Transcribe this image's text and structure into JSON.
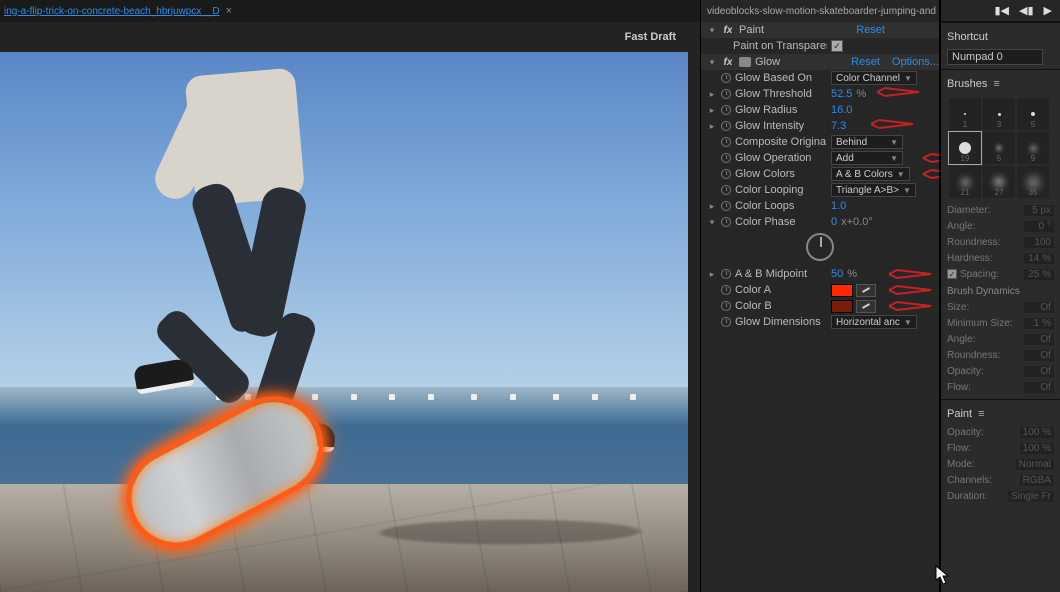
{
  "left": {
    "tab_label": "ing-a-flip-trick-on-concrete-beach_hbrjuwpcx__D",
    "draft_label": "Fast Draft"
  },
  "effects": {
    "tab_label": "videoblocks-slow-motion-skateboarder-jumping-and",
    "paint": {
      "label": "Paint",
      "reset": "Reset",
      "transparent_label": "Paint on Transparent",
      "transparent_checked": true
    },
    "glow": {
      "label": "Glow",
      "reset": "Reset",
      "options": "Options...",
      "based_on": {
        "label": "Glow Based On",
        "value": "Color Channel"
      },
      "threshold": {
        "label": "Glow Threshold",
        "value": "52.5",
        "unit": "%"
      },
      "radius": {
        "label": "Glow Radius",
        "value": "16.0"
      },
      "intensity": {
        "label": "Glow Intensity",
        "value": "7.3"
      },
      "composite": {
        "label": "Composite Origina",
        "value": "Behind"
      },
      "operation": {
        "label": "Glow Operation",
        "value": "Add"
      },
      "colors": {
        "label": "Glow Colors",
        "value": "A & B Colors"
      },
      "looping": {
        "label": "Color Looping",
        "value": "Triangle A>B>"
      },
      "loops": {
        "label": "Color Loops",
        "value": "1.0"
      },
      "phase": {
        "label": "Color Phase",
        "value": "0",
        "suffix": "x+0.0°"
      },
      "midpoint": {
        "label": "A & B Midpoint",
        "value": "50",
        "unit": "%"
      },
      "colorA": {
        "label": "Color A",
        "hex": "#ff2a00"
      },
      "colorB": {
        "label": "Color B",
        "hex": "#7a1e0a"
      },
      "dimensions": {
        "label": "Glow Dimensions",
        "value": "Horizontal anc"
      }
    }
  },
  "right": {
    "shortcut": {
      "title": "Shortcut",
      "value": "Numpad 0"
    },
    "brushes": {
      "title": "Brushes",
      "items": [
        {
          "size": 2,
          "label": "1",
          "blur": 0
        },
        {
          "size": 3,
          "label": "3",
          "blur": 0
        },
        {
          "size": 4,
          "label": "5",
          "blur": 0
        },
        {
          "size": 12,
          "label": "19",
          "blur": 0,
          "selected": true
        },
        {
          "size": 4,
          "label": "5",
          "blur": 2
        },
        {
          "size": 5,
          "label": "9",
          "blur": 3
        },
        {
          "size": 7,
          "label": "21",
          "blur": 4
        },
        {
          "size": 8,
          "label": "27",
          "blur": 4
        },
        {
          "size": 9,
          "label": "35",
          "blur": 5
        }
      ],
      "props": {
        "diameter": {
          "label": "Diameter:",
          "value": "5 px"
        },
        "angle": {
          "label": "Angle:",
          "value": "0 °"
        },
        "roundness": {
          "label": "Roundness:",
          "value": "100"
        },
        "hardness": {
          "label": "Hardness:",
          "value": "14 %"
        },
        "spacing": {
          "label": "Spacing:",
          "value": "25 %",
          "checked": true
        }
      },
      "dynamics_title": "Brush Dynamics",
      "dynamics": {
        "size": {
          "label": "Size:",
          "value": "Of"
        },
        "minsize": {
          "label": "Minimum Size:",
          "value": "1 %"
        },
        "angle": {
          "label": "Angle:",
          "value": "Of"
        },
        "round": {
          "label": "Roundness:",
          "value": "Of"
        },
        "opacity": {
          "label": "Opacity:",
          "value": "Of"
        },
        "flow": {
          "label": "Flow:",
          "value": "Of"
        }
      }
    },
    "paint": {
      "title": "Paint",
      "opacity": {
        "label": "Opacity:",
        "value": "100 %"
      },
      "flow": {
        "label": "Flow:",
        "value": "100 %"
      },
      "mode": {
        "label": "Mode:",
        "value": "Normal"
      },
      "channels": {
        "label": "Channels:",
        "value": "RGBA"
      },
      "duration": {
        "label": "Duration:",
        "value": "Single Fr"
      }
    }
  }
}
